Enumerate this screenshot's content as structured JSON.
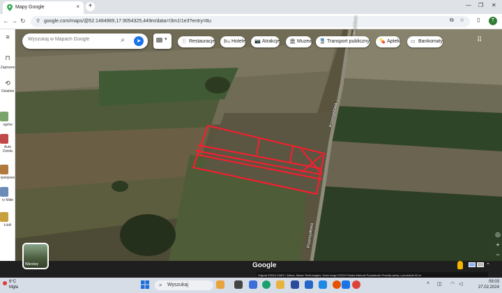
{
  "browser": {
    "tab_title": "Mapy Google",
    "tab_close": "×",
    "new_tab": "+",
    "url": "google.com/maps/@52.1484969,17.9054325,449m/data=!3m1!1e3?entry=ttu",
    "avatar_letter": "T"
  },
  "search": {
    "placeholder": "Wyszukaj w Mapach Google"
  },
  "chips": [
    {
      "label": "Restauracje",
      "icon": "fork-knife-icon"
    },
    {
      "label": "Hotele",
      "icon": "bed-icon"
    },
    {
      "label": "Atrakcje",
      "icon": "camera-icon"
    },
    {
      "label": "Muzea",
      "icon": "museum-icon"
    },
    {
      "label": "Transport publiczny",
      "icon": "train-icon"
    },
    {
      "label": "Apteki",
      "icon": "pill-icon"
    },
    {
      "label": "Bankomaty",
      "icon": "atm-icon"
    }
  ],
  "rail": {
    "saved": "Zapisane",
    "recent": "Ostatnie",
    "items": [
      "ogrów",
      "Auto Dzieła",
      "ięsiejewo",
      "ry Małe",
      "Łódź"
    ]
  },
  "map": {
    "road_label_1": "Przemysłowa",
    "road_label_2": "Przemysłowa",
    "road_label_3": "Przemysłowa",
    "layer_label": "Warstwy",
    "logo": "Google",
    "attribution": "Zdjęcia ©2024 CNES / Airbus, Maxar Technologies, Dane mapy ©2024   Polska   Warunki   Prywatność   Prześlij opinię o produkcie   50 m"
  },
  "taskbar": {
    "temp": "6°C",
    "weather": "Mgła",
    "search_label": "Wyszukaj",
    "time": "09:03",
    "date": "27.02.2024"
  },
  "colors": {
    "parcel_outline": "#ff1a2e",
    "accent": "#1a73e8"
  }
}
